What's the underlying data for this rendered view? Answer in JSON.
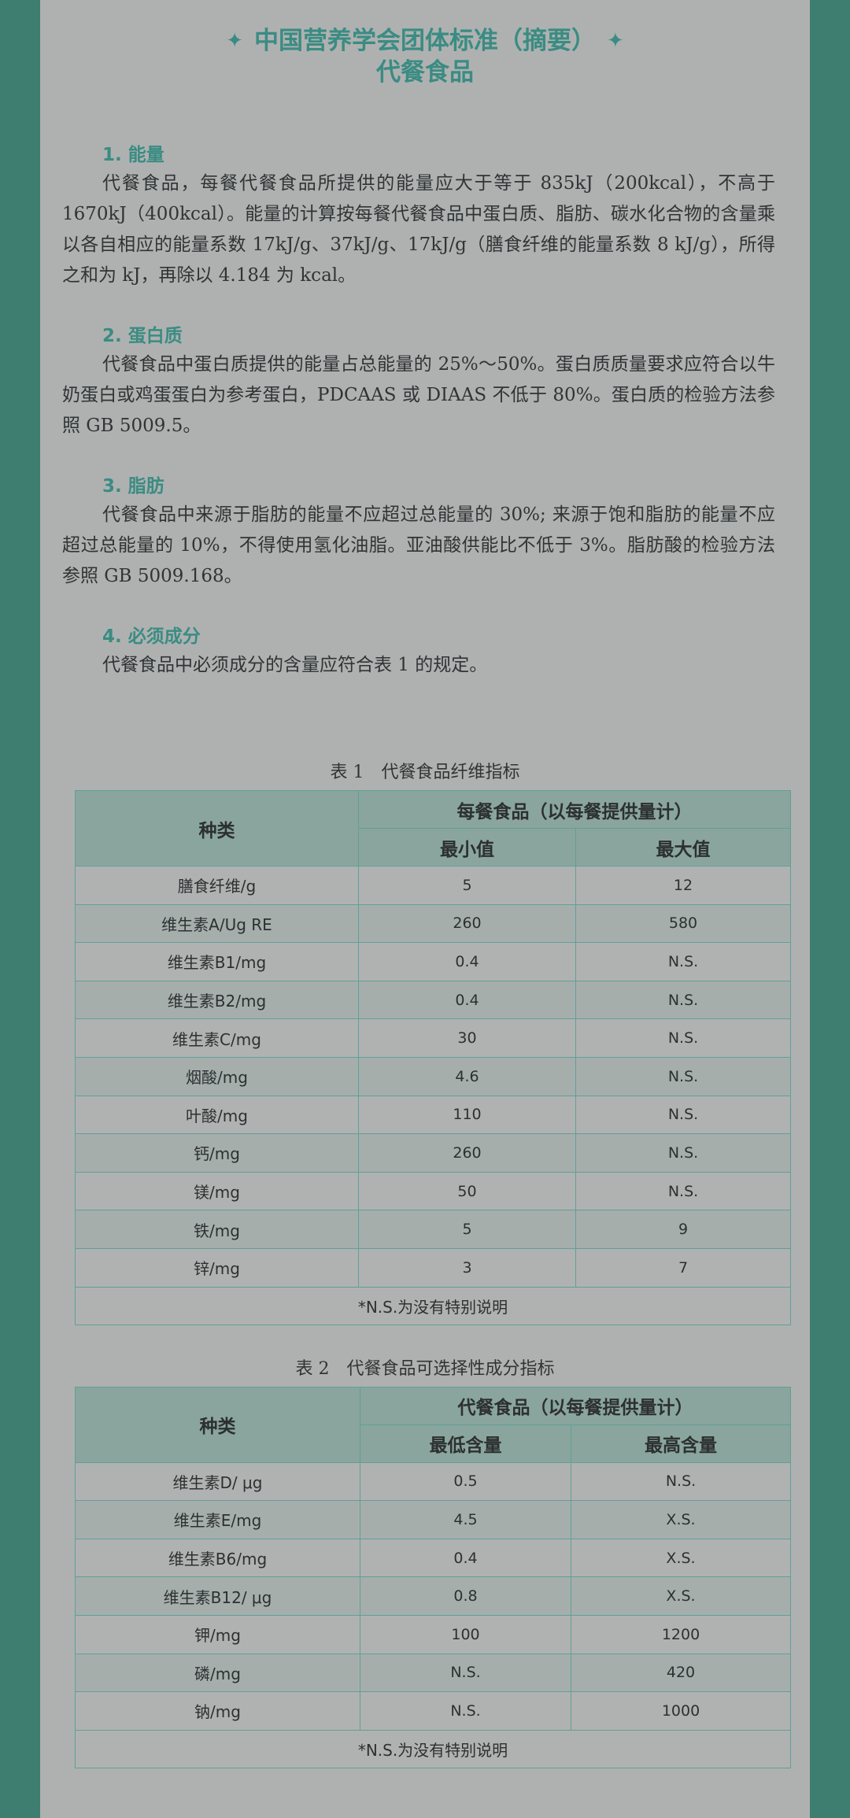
{
  "title_line1": "中国营养学会团体标准（摘要）",
  "title_line2": "代餐食品",
  "star_glyph": "✦",
  "sections": [
    {
      "heading": "1. 能量",
      "text": "代餐食品，每餐代餐食品所提供的能量应大于等于 835kJ（200kcal），不高于1670kJ（400kcal）。能量的计算按每餐代餐食品中蛋白质、脂肪、碳水化合物的含量乘以各自相应的能量系数 17kJ/g、37kJ/g、17kJ/g（膳食纤维的能量系数 8 kJ/g），所得之和为 kJ，再除以 4.184 为 kcal。"
    },
    {
      "heading": "2. 蛋白质",
      "text": "代餐食品中蛋白质提供的能量占总能量的 25%～50%。蛋白质质量要求应符合以牛奶蛋白或鸡蛋蛋白为参考蛋白，PDCAAS 或 DIAAS 不低于 80%。蛋白质的检验方法参照 GB 5009.5。"
    },
    {
      "heading": "3. 脂肪",
      "text": "代餐食品中来源于脂肪的能量不应超过总能量的 30%; 来源于饱和脂肪的能量不应超过总能量的 10%，不得使用氢化油脂。亚油酸供能比不低于 3%。脂肪酸的检验方法参照 GB 5009.168。"
    },
    {
      "heading": "4. 必须成分",
      "text": "代餐食品中必须成分的含量应符合表 1 的规定。"
    }
  ],
  "table1": {
    "caption": "表 1　代餐食品纤维指标",
    "head_type": "种类",
    "head_group": "每餐食品（以每餐提供量计）",
    "head_min": "最小值",
    "head_max": "最大值",
    "rows": [
      [
        "膳食纤维/g",
        "5",
        "12"
      ],
      [
        "维生素A/Ug RE",
        "260",
        "580"
      ],
      [
        "维生素B1/mg",
        "0.4",
        "N.S."
      ],
      [
        "维生素B2/mg",
        "0.4",
        "N.S."
      ],
      [
        "维生素C/mg",
        "30",
        "N.S."
      ],
      [
        "烟酸/mg",
        "4.6",
        "N.S."
      ],
      [
        "叶酸/mg",
        "110",
        "N.S."
      ],
      [
        "钙/mg",
        "260",
        "N.S."
      ],
      [
        "镁/mg",
        "50",
        "N.S."
      ],
      [
        "铁/mg",
        "5",
        "9"
      ],
      [
        "锌/mg",
        "3",
        "7"
      ]
    ],
    "note": "*N.S.为没有特别说明"
  },
  "table2": {
    "caption": "表 2　代餐食品可选择性成分指标",
    "head_type": "种类",
    "head_group": "代餐食品（以每餐提供量计）",
    "head_min": "最低含量",
    "head_max": "最高含量",
    "rows": [
      [
        "维生素D/ μg",
        "0.5",
        "N.S."
      ],
      [
        "维生素E/mg",
        "4.5",
        "X.S."
      ],
      [
        "维生素B6/mg",
        "0.4",
        "X.S."
      ],
      [
        "维生素B12/ μg",
        "0.8",
        "X.S."
      ],
      [
        "钾/mg",
        "100",
        "1200"
      ],
      [
        "磷/mg",
        "N.S.",
        "420"
      ],
      [
        "钠/mg",
        "N.S.",
        "1000"
      ]
    ],
    "note": "*N.S.为没有特别说明"
  }
}
